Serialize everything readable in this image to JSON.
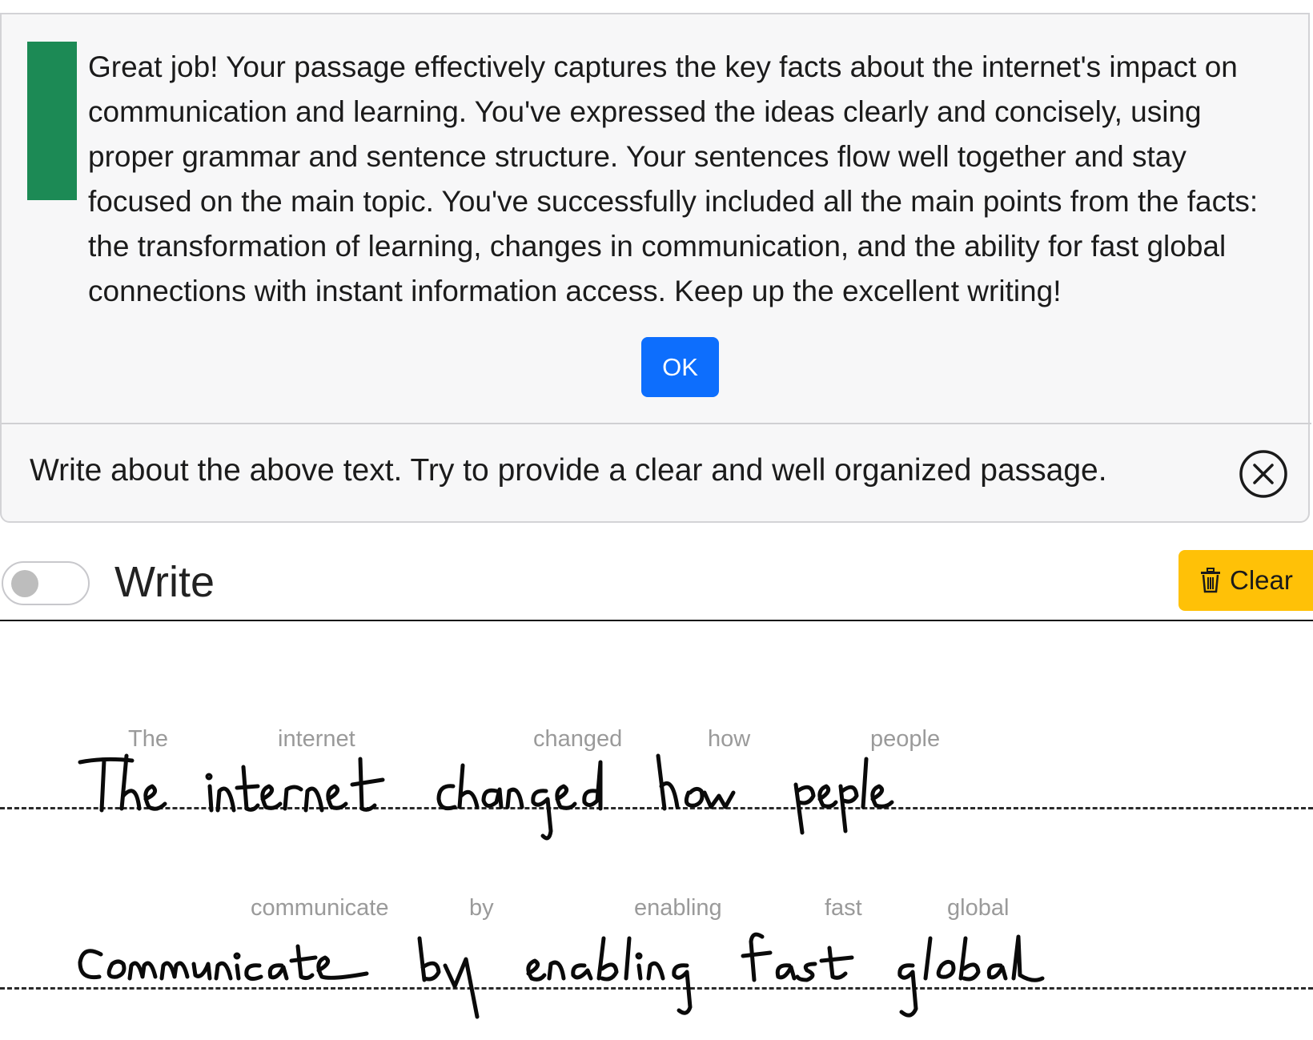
{
  "feedback": {
    "message": "Great job! Your passage effectively captures the key facts about the internet's impact on communication and learning. You've expressed the ideas clearly and concisely, using proper grammar and sentence structure. Your sentences flow well together and stay focused on the main topic. You've successfully included all the main points from the facts: the transformation of learning, changes in communication, and the ability for fast global connections with instant information access. Keep up the excellent writing!",
    "ok_label": "OK",
    "accent_color": "#1c8a55"
  },
  "prompt": {
    "text": "Write about the above text. Try to provide a clear and well organized passage.",
    "close_icon": "close-circle-icon"
  },
  "toolbar": {
    "mode_label": "Write",
    "toggle_on": false,
    "clear_label": "Clear",
    "clear_icon": "trash-icon",
    "clear_color": "#ffc107"
  },
  "handwriting": {
    "lines": [
      {
        "recognized_words": [
          "The",
          "internet",
          "changed",
          "how",
          "people"
        ]
      },
      {
        "recognized_words": [
          "communicate",
          "by",
          "enabling",
          "fast",
          "global"
        ]
      }
    ]
  }
}
